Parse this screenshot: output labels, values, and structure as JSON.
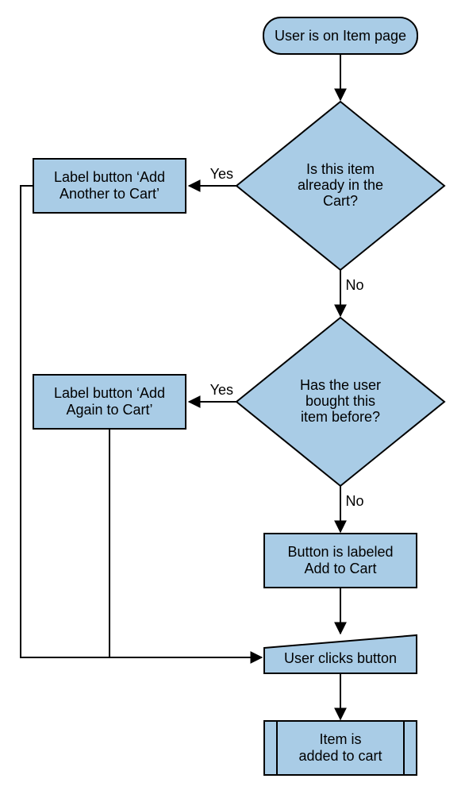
{
  "nodes": {
    "start": "User is on Item page",
    "decision_in_cart_l1": "Is this item",
    "decision_in_cart_l2": "already in the",
    "decision_in_cart_l3": "Cart?",
    "label_add_another_l1": "Label button ‘Add",
    "label_add_another_l2": "Another to Cart’",
    "decision_bought_l1": "Has the user",
    "decision_bought_l2": "bought this",
    "decision_bought_l3": "item before?",
    "label_add_again_l1": "Label button ‘Add",
    "label_add_again_l2": "Again to Cart’",
    "label_add_to_cart_l1": "Button is labeled",
    "label_add_to_cart_l2": "Add to Cart",
    "user_clicks": "User clicks button",
    "added_l1": "Item is",
    "added_l2": "added to cart"
  },
  "edges": {
    "yes": "Yes",
    "no": "No"
  }
}
